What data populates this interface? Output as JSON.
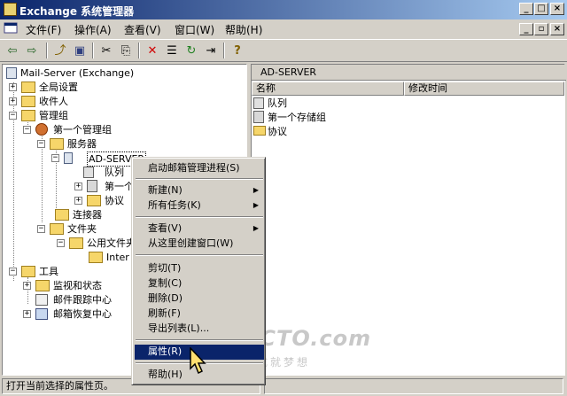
{
  "window": {
    "title": "Exchange 系统管理器",
    "controls": [
      "_",
      "□",
      "×"
    ],
    "inner_controls": [
      "_",
      "▫",
      "×"
    ]
  },
  "menubar": {
    "items": [
      {
        "label": "文件(F)"
      },
      {
        "label": "操作(A)"
      },
      {
        "label": "查看(V)"
      },
      {
        "label": "窗口(W)"
      },
      {
        "label": "帮助(H)"
      }
    ]
  },
  "toolbar": {
    "buttons": [
      {
        "icon": "back-arrow-icon",
        "glyph": "⇦"
      },
      {
        "icon": "forward-arrow-icon",
        "glyph": "⇨"
      },
      {
        "icon": "up-folder-icon",
        "glyph": "⤴"
      },
      {
        "icon": "show-hide-tree-icon",
        "glyph": "▣"
      },
      {
        "icon": "cut-icon",
        "glyph": "✂"
      },
      {
        "icon": "copy-icon",
        "glyph": "⎘"
      },
      {
        "icon": "delete-icon",
        "glyph": "✕"
      },
      {
        "icon": "properties-icon",
        "glyph": "☰"
      },
      {
        "icon": "refresh-icon",
        "glyph": "↻"
      },
      {
        "icon": "export-icon",
        "glyph": "⇥"
      },
      {
        "icon": "help-icon",
        "glyph": "?"
      }
    ]
  },
  "tree": {
    "root": "Mail-Server (Exchange)",
    "nodes": [
      {
        "label": "全局设置",
        "expander": "+"
      },
      {
        "label": "收件人",
        "expander": "+"
      },
      {
        "label": "管理组",
        "expander": "−"
      },
      {
        "label": "第一个管理组",
        "expander": "−"
      },
      {
        "label": "服务器",
        "expander": "−"
      },
      {
        "label": "AD-SERVER",
        "expander": "−"
      },
      {
        "label": "队列",
        "expander": ""
      },
      {
        "label": "第一个",
        "expander": "+"
      },
      {
        "label": "协议",
        "expander": "+"
      },
      {
        "label": "连接器",
        "expander": ""
      },
      {
        "label": "文件夹",
        "expander": "−"
      },
      {
        "label": "公用文件夹",
        "expander": "−"
      },
      {
        "label": "Inter",
        "expander": ""
      },
      {
        "label": "工具",
        "expander": "−"
      },
      {
        "label": "监视和状态",
        "expander": "+"
      },
      {
        "label": "邮件跟踪中心",
        "expander": ""
      },
      {
        "label": "邮箱恢复中心",
        "expander": "+"
      }
    ]
  },
  "right_pane": {
    "title": "AD-SERVER",
    "columns": [
      "名称",
      "修改时间"
    ],
    "items": [
      {
        "name": "队列"
      },
      {
        "name": "第一个存储组"
      },
      {
        "name": "协议"
      }
    ]
  },
  "context_menu": {
    "items": [
      {
        "label": "启动邮箱管理进程(S)",
        "submenu": false
      },
      {
        "label": "新建(N)",
        "submenu": true
      },
      {
        "label": "所有任务(K)",
        "submenu": true
      },
      {
        "label": "查看(V)",
        "submenu": true
      },
      {
        "label": "从这里创建窗口(W)",
        "submenu": false
      },
      {
        "label": "剪切(T)",
        "submenu": false
      },
      {
        "label": "复制(C)",
        "submenu": false
      },
      {
        "label": "删除(D)",
        "submenu": false
      },
      {
        "label": "刷新(F)",
        "submenu": false
      },
      {
        "label": "导出列表(L)...",
        "submenu": false
      },
      {
        "label": "属性(R)",
        "submenu": false,
        "highlighted": true
      },
      {
        "label": "帮助(H)",
        "submenu": false
      }
    ]
  },
  "statusbar": {
    "text": "打开当前选择的属性页。"
  },
  "watermark": {
    "line1": "51CTO.com",
    "line2": "技术成就梦想"
  },
  "colors": {
    "title_gradient_start": "#0a246a",
    "title_gradient_end": "#a6caf0",
    "highlight": "#0a246a",
    "face": "#d4d0c8"
  }
}
